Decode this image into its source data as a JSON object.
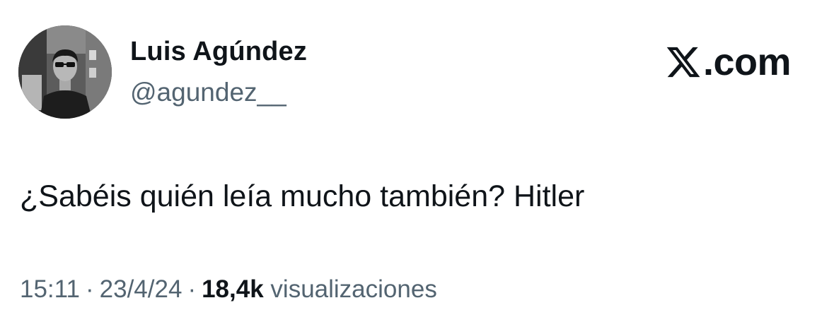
{
  "author": {
    "display_name": "Luis Agúndez",
    "handle": "@agundez__",
    "avatar_icon": "profile-photo"
  },
  "brand": {
    "logo_icon": "x-logo-icon",
    "domain": ".com"
  },
  "tweet": {
    "text": "¿Sabéis quién leía mucho también? Hitler"
  },
  "meta": {
    "time": "15:11",
    "separator": "·",
    "date": "23/4/24",
    "views_count": "18,4k",
    "views_label": "visualizaciones"
  },
  "colors": {
    "text_primary": "#0f1419",
    "text_secondary": "#536471",
    "background": "#ffffff"
  }
}
